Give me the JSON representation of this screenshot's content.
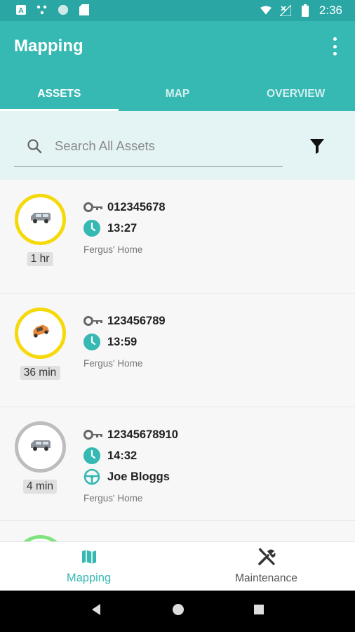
{
  "statusbar": {
    "time": "2:36",
    "left_icons": [
      "a-notification-icon",
      "network-dots-icon",
      "circle-icon",
      "sd-card-icon"
    ],
    "right_icons": [
      "wifi-icon",
      "signal-off-icon",
      "battery-icon"
    ]
  },
  "appbar": {
    "title": "Mapping",
    "menu_icon": "more-vert-icon"
  },
  "tabs": [
    {
      "label": "ASSETS",
      "active": true
    },
    {
      "label": "MAP",
      "active": false
    },
    {
      "label": "OVERVIEW",
      "active": false
    }
  ],
  "search": {
    "placeholder": "Search All Assets",
    "icon": "search-icon",
    "filter_icon": "filter-icon"
  },
  "assets": [
    {
      "key_id": "012345678",
      "time": "13:27",
      "driver": null,
      "location": "Fergus' Home",
      "age": "1 hr",
      "ring": "yellow",
      "vehicle": "van"
    },
    {
      "key_id": "123456789",
      "time": "13:59",
      "driver": null,
      "location": "Fergus' Home",
      "age": "36 min",
      "ring": "yellow",
      "vehicle": "car"
    },
    {
      "key_id": "12345678910",
      "time": "14:32",
      "driver": "Joe Bloggs",
      "location": "Fergus' Home",
      "age": "4 min",
      "ring": "grey",
      "vehicle": "van"
    },
    {
      "ring": "green"
    }
  ],
  "bottom_nav": [
    {
      "label": "Mapping",
      "icon": "map-icon",
      "active": true
    },
    {
      "label": "Maintenance",
      "icon": "tools-icon",
      "active": false
    }
  ],
  "colors": {
    "primary": "#36b8b3",
    "statusbar": "#2aa7a4",
    "search_band": "#e4f3f3",
    "ring_yellow": "#f5d90a",
    "ring_grey": "#bdbdbd",
    "ring_green": "#7fe37f"
  }
}
